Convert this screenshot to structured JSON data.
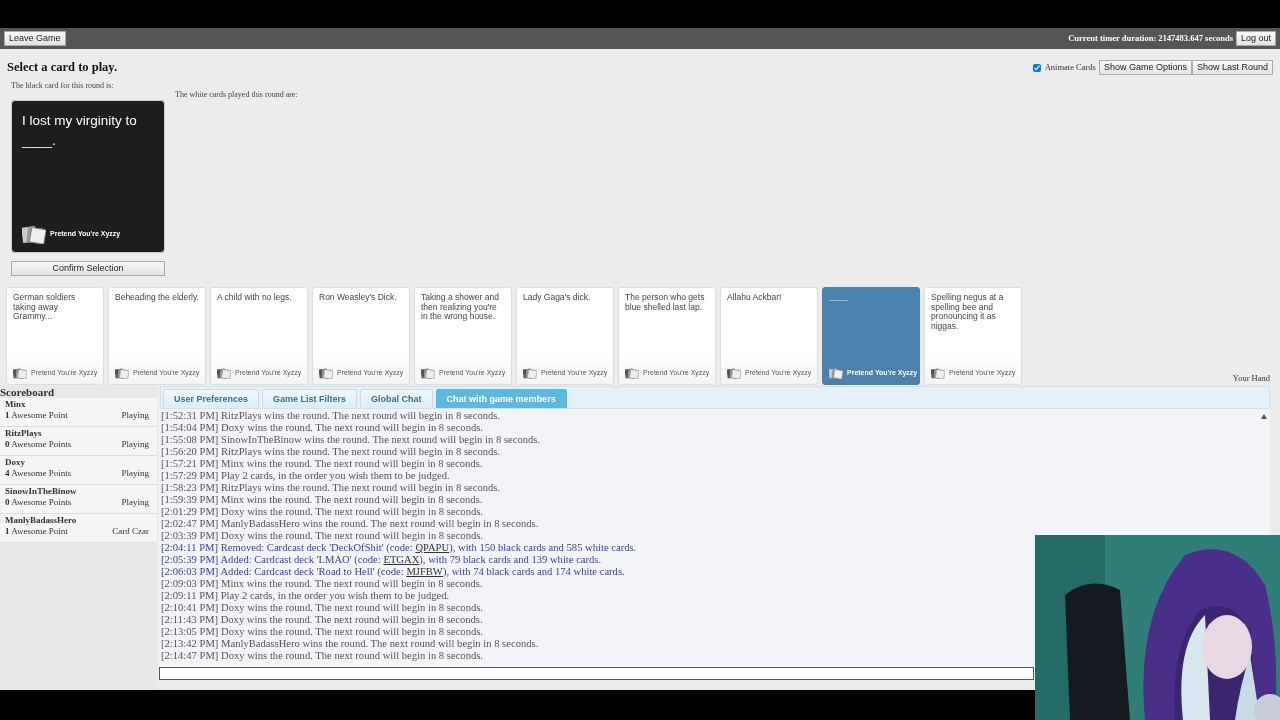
{
  "top_bar": {
    "leave_button": "Leave Game",
    "timer": "Current timer duration: 2147483.647 seconds",
    "logout_button": "Log out"
  },
  "heading": "Select a card to play.",
  "options": {
    "animate_label": "Animate Cards",
    "animate_checked": true,
    "buttons": [
      "Show Game Options",
      "Show Last Round"
    ]
  },
  "black_card_label": "The black card for this round is:",
  "white_cards_label": "The white cards played this round are:",
  "black_card": {
    "text": "I lost my virginity to ____.",
    "brand": "Pretend You're Xyzzy"
  },
  "confirm_button": "Confirm Selection",
  "hand": [
    {
      "text": "German soldiers taking away Grammy...",
      "brand": "Pretend You're Xyzzy",
      "selected": false
    },
    {
      "text": "Beheading the elderly.",
      "brand": "Pretend You're Xyzzy",
      "selected": false
    },
    {
      "text": "A child with no legs.",
      "brand": "Pretend You're Xyzzy",
      "selected": false
    },
    {
      "text": "Ron Weasley's Dick.",
      "brand": "Pretend You're Xyzzy",
      "selected": false
    },
    {
      "text": "Taking a shower and then realizing you're in the wrong house.",
      "brand": "Pretend You're Xyzzy",
      "selected": false
    },
    {
      "text": "Lady Gaga's dick.",
      "brand": "Pretend You're Xyzzy",
      "selected": false
    },
    {
      "text": "The person who gets blue shelled last lap.",
      "brand": "Pretend You're Xyzzy",
      "selected": false
    },
    {
      "text": "Allahu Ackbar!",
      "brand": "Pretend You're Xyzzy",
      "selected": false
    },
    {
      "text": "____",
      "brand": "Pretend You're Xyzzy",
      "selected": true
    },
    {
      "text": "Spelling negus at a spelling bee and pronouncing it as niggas.",
      "brand": "Pretend You're Xyzzy",
      "selected": false
    }
  ],
  "hand_label": "Your Hand",
  "scoreboard": {
    "title": "Scoreboard",
    "players": [
      {
        "name": "Minx",
        "score": "**1** Awesome Point",
        "status": "Playing"
      },
      {
        "name": "RitzPlays",
        "score": "**0** Awesome Points",
        "status": "Playing"
      },
      {
        "name": "Doxy",
        "score": "**4** Awesome Points",
        "status": "Playing"
      },
      {
        "name": "SinowInTheBinow",
        "score": "**0** Awesome Points",
        "status": "Playing"
      },
      {
        "name": "ManlyBadassHero",
        "score": "**1** Awesome Point",
        "status": "Card Czar"
      }
    ]
  },
  "tabs": [
    {
      "label": "User Preferences",
      "selected": false
    },
    {
      "label": "Game List Filters",
      "selected": false
    },
    {
      "label": "Global Chat",
      "selected": false
    },
    {
      "label": "Chat with game members",
      "selected": true
    }
  ],
  "chat": [
    {
      "kind": "event",
      "text": "[1:52:31 PM] RitzPlays wins the round. The next round will begin in 8 seconds."
    },
    {
      "kind": "event",
      "text": "[1:54:04 PM] Doxy wins the round. The next round will begin in 8 seconds."
    },
    {
      "kind": "event",
      "text": "[1:55:08 PM] SinowInTheBinow wins the round. The next round will begin in 8 seconds."
    },
    {
      "kind": "event",
      "text": "[1:56:20 PM] RitzPlays wins the round. The next round will begin in 8 seconds."
    },
    {
      "kind": "event",
      "text": "[1:57:21 PM] Minx wins the round. The next round will begin in 8 seconds."
    },
    {
      "kind": "event",
      "text": "[1:57:29 PM] Play 2 cards, in the order you wish them to be judged."
    },
    {
      "kind": "event",
      "text": "[1:58:23 PM] RitzPlays wins the round. The next round will begin in 8 seconds."
    },
    {
      "kind": "event",
      "text": "[1:59:39 PM] Minx wins the round. The next round will begin in 8 seconds."
    },
    {
      "kind": "event",
      "text": "[2:01:29 PM] Doxy wins the round. The next round will begin in 8 seconds."
    },
    {
      "kind": "event",
      "text": "[2:02:47 PM] ManlyBadassHero wins the round. The next round will begin in 8 seconds."
    },
    {
      "kind": "event",
      "text": "[2:03:39 PM] Doxy wins the round. The next round will begin in 8 seconds."
    },
    {
      "kind": "deck",
      "text": "[2:04:11 PM] Removed: Cardcast deck 'DeckOfShit' (code: ",
      "code": "QPAPU",
      "after": "), with 150 black cards and 585 white cards."
    },
    {
      "kind": "deck",
      "text": "[2:05:39 PM] Added: Cardcast deck 'LMAO' (code: ",
      "code": "ETGAX",
      "after": "), with 79 black cards and 139 white cards."
    },
    {
      "kind": "deck",
      "text": "[2:06:03 PM] Added: Cardcast deck 'Road to Hell' (code: ",
      "code": "MJFBW",
      "after": "), with 74 black cards and 174 white cards."
    },
    {
      "kind": "event",
      "text": "[2:09:03 PM] Minx wins the round. The next round will begin in 8 seconds."
    },
    {
      "kind": "event",
      "text": "[2:09:11 PM] Play 2 cards, in the order you wish them to be judged."
    },
    {
      "kind": "event",
      "text": "[2:10:41 PM] Doxy wins the round. The next round will begin in 8 seconds."
    },
    {
      "kind": "event",
      "text": "[2:11:43 PM] Doxy wins the round. The next round will begin in 8 seconds."
    },
    {
      "kind": "event",
      "text": "[2:13:05 PM] Doxy wins the round. The next round will begin in 8 seconds."
    },
    {
      "kind": "event",
      "text": "[2:13:42 PM] ManlyBadassHero wins the round. The next round will begin in 8 seconds."
    },
    {
      "kind": "event",
      "text": "[2:14:47 PM] Doxy wins the round. The next round will begin in 8 seconds."
    }
  ]
}
